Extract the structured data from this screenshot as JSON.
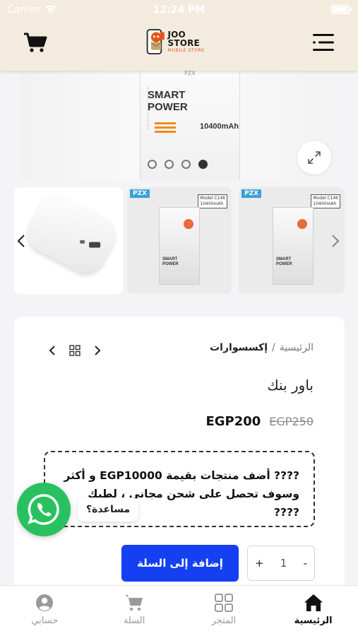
{
  "status_bar": {
    "carrier": "Carrier",
    "time": "12:24 PM"
  },
  "header": {
    "logo_title": "JOO STORE",
    "logo_subtitle": "MOBILE STORE",
    "cart_icon": "cart-icon",
    "menu_icon": "menu-icon"
  },
  "gallery": {
    "main_image": {
      "brand": "PZX",
      "line1": "SMART",
      "line2": "POWER",
      "capacity": "10400mAh"
    },
    "dots_count": 4,
    "active_dot": 3,
    "thumbnails": [
      {
        "tag_brand": "",
        "model": "",
        "capacity": ""
      },
      {
        "tag_brand": "PZX",
        "model": "Model C146",
        "capacity": "10400mAh"
      },
      {
        "tag_brand": "PZX",
        "model": "Model C146",
        "capacity": "10400mAh"
      }
    ]
  },
  "product": {
    "breadcrumb_home": "الرئيسية",
    "breadcrumb_sep": "/",
    "breadcrumb_current": "إكسسوارات",
    "title": "باور بنك",
    "price_current": "EGP200",
    "price_old": "EGP250",
    "promo_text": "???? أضف منتجات بقيمة EGP10000 و أكثر وسوف تحصل على شحن مجاني ، لطبك ????",
    "quantity": "1",
    "qty_plus": "+",
    "qty_minus": "-",
    "add_to_cart": "إضافة إلى السلة"
  },
  "whatsapp": {
    "tooltip": "مساعدة؟"
  },
  "tabbar": {
    "items": [
      {
        "label": "حسابي",
        "icon": "account-icon"
      },
      {
        "label": "السلة",
        "icon": "cart-icon"
      },
      {
        "label": "المتجر",
        "icon": "store-grid-icon"
      },
      {
        "label": "الرئيسية",
        "icon": "home-icon"
      }
    ],
    "active_index": 3
  },
  "colors": {
    "header_bg": "#f4ebdf",
    "accent_blue": "#1540f2",
    "whatsapp_green": "#29c15f"
  }
}
